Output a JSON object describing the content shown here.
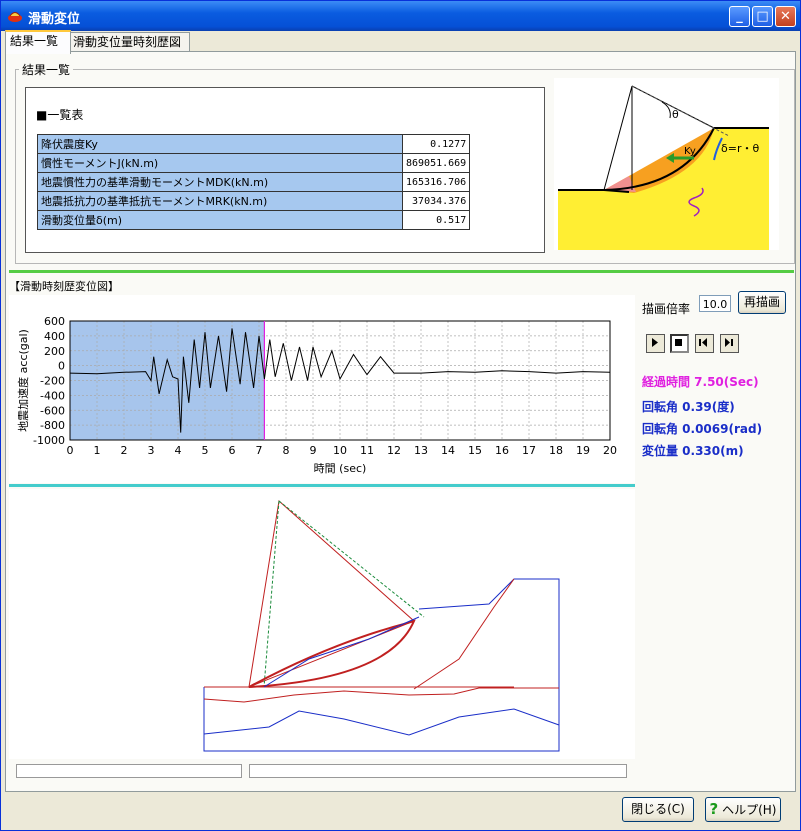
{
  "window": {
    "title": "滑動変位",
    "minimize_label": "_",
    "maximize_label": "□",
    "close_label": "✕"
  },
  "tabs": [
    {
      "label": "結果一覧"
    },
    {
      "label": "滑動変位量時刻歴図"
    }
  ],
  "results": {
    "group_label": "結果一覧",
    "table_heading": "■一覧表",
    "rows": [
      {
        "label": "降伏震度Ky",
        "value": "0.1277"
      },
      {
        "label": "慣性モーメントJ(kN.m)",
        "value": "869051.669"
      },
      {
        "label": "地震慣性力の基準滑動モーメントMDK(kN.m)",
        "value": "165316.706"
      },
      {
        "label": "地震抵抗力の基準抵抗モーメントMRK(kN.m)",
        "value": "37034.376"
      },
      {
        "label": "滑動変位量δ(m)",
        "value": "0.517"
      }
    ],
    "diagram": {
      "theta_label": "θ",
      "ky_label": "Ky",
      "formula": "δ=r・θ"
    }
  },
  "history": {
    "section_title": "【滑動時刻歴変位図】",
    "scale_label": "描画倍率",
    "scale_value": "10.0",
    "redraw_label": "再描画",
    "elapsed": "経過時間 7.50(Sec)",
    "rotation_deg": "回転角 0.39(度)",
    "rotation_rad": "回転角 0.0069(rad)",
    "displacement": "変位量 0.330(m)"
  },
  "chart_data": {
    "type": "line",
    "title": "",
    "xlabel": "時間 (sec)",
    "ylabel": "地震加速度 acc(gal)",
    "xlim": [
      0,
      20
    ],
    "ylim": [
      -1000,
      600
    ],
    "xticks": [
      "0",
      "1",
      "2",
      "3",
      "4",
      "5",
      "6",
      "7",
      "8",
      "9",
      "10",
      "11",
      "12",
      "13",
      "14",
      "15",
      "16",
      "17",
      "18",
      "19",
      "20"
    ],
    "yticks": [
      "600",
      "400",
      "200",
      "0",
      "-200",
      "-400",
      "-600",
      "-800",
      "-1000"
    ],
    "grid": true,
    "highlight_until": 7.2,
    "x": [
      0,
      1,
      2,
      2.8,
      3,
      3.1,
      3.3,
      3.6,
      3.8,
      4,
      4.1,
      4.2,
      4.4,
      4.6,
      4.8,
      5,
      5.2,
      5.5,
      5.8,
      6,
      6.3,
      6.5,
      6.8,
      7,
      7.2,
      7.4,
      7.6,
      7.9,
      8.2,
      8.5,
      8.8,
      9,
      9.3,
      9.7,
      10,
      10.5,
      11,
      11.5,
      12,
      13,
      14,
      15,
      16,
      17,
      18,
      19,
      20
    ],
    "y": [
      -100,
      -110,
      -90,
      -80,
      -200,
      120,
      -380,
      80,
      -150,
      -180,
      -900,
      120,
      -500,
      350,
      -300,
      450,
      -300,
      400,
      -350,
      500,
      -250,
      450,
      -300,
      400,
      -180,
      350,
      -150,
      300,
      -200,
      250,
      -200,
      250,
      -150,
      200,
      -180,
      150,
      -120,
      120,
      -100,
      -100,
      -80,
      -90,
      -70,
      -80,
      -100,
      -80,
      -90
    ]
  },
  "footer": {
    "close_label": "閉じる(C)",
    "help_label": "ヘルプ(H)"
  }
}
